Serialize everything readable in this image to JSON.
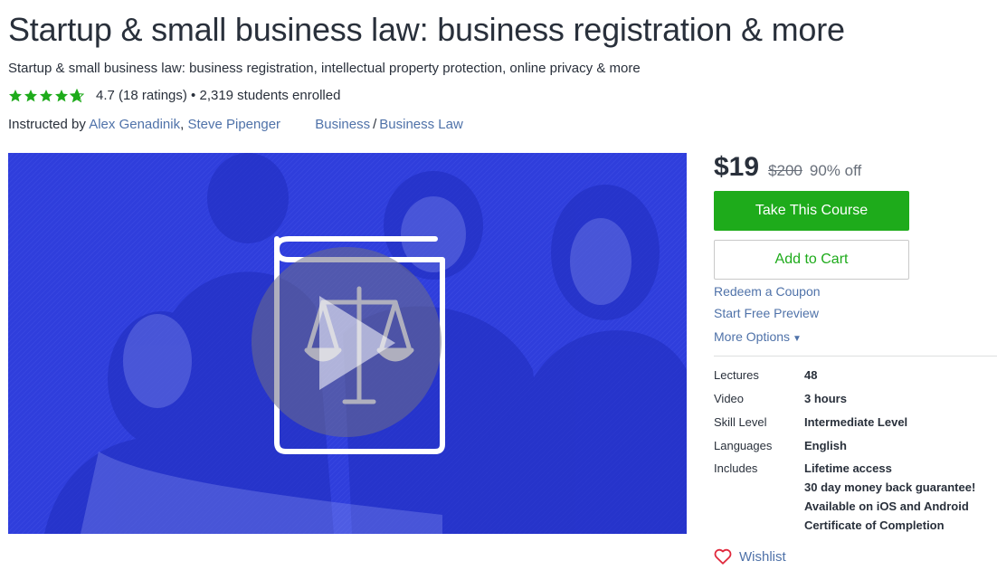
{
  "course": {
    "title": "Startup & small business law: business registration & more",
    "subtitle": "Startup & small business law: business registration, intellectual property protection, online privacy & more",
    "rating_text": "4.7 (18 ratings) • 2,319 students enrolled",
    "rating_value": 4.7,
    "instructed_by": "Instructed by ",
    "instructors": [
      "Alex Genadinik",
      "Steve Pipenger"
    ],
    "comma": ",",
    "categories": [
      "Business",
      "Business Law"
    ],
    "category_sep": "/"
  },
  "purchase": {
    "price": "$19",
    "old_price": "$200",
    "discount": "90% off",
    "take_course": "Take This Course",
    "add_to_cart": "Add to Cart",
    "redeem_coupon": "Redeem a Coupon",
    "free_preview": "Start Free Preview",
    "more_options": "More Options"
  },
  "details": {
    "lectures_label": "Lectures",
    "lectures_value": "48",
    "video_label": "Video",
    "video_value": "3 hours",
    "skill_label": "Skill Level",
    "skill_value": "Intermediate Level",
    "languages_label": "Languages",
    "languages_value": "English",
    "includes_label": "Includes",
    "includes": [
      "Lifetime access",
      "30 day money back guarantee!",
      "Available on iOS and Android",
      "Certificate of Completion"
    ]
  },
  "wishlist": "Wishlist",
  "colors": {
    "brand_green": "#1eab1b",
    "link_blue": "#4f72a9",
    "video_blue": "#2f3edc",
    "star_green": "#1eab1b",
    "heart_red": "#e0283c"
  },
  "icons": {
    "star": "star-icon",
    "play": "play-icon",
    "law_book": "law-book-icon",
    "heart": "heart-icon",
    "caret": "caret-down-icon"
  }
}
